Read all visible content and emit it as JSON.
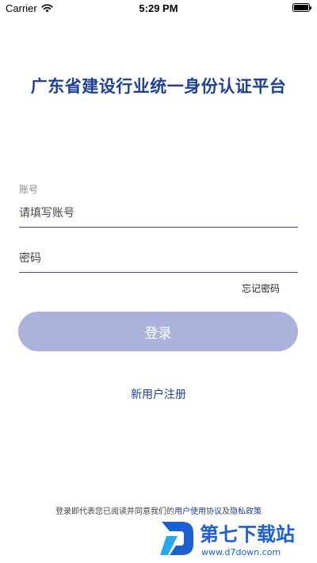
{
  "status_bar": {
    "carrier": "Carrier",
    "time": "5:29 PM",
    "wifi_icon": "wifi-icon",
    "battery_icon": "battery-icon"
  },
  "app": {
    "title": "广东省建设行业统一身份认证平台"
  },
  "form": {
    "account_label": "账号",
    "account_placeholder": "请填写账号",
    "password_placeholder": "密码",
    "forgot_password": "忘记密码",
    "login_button": "登录",
    "register_link": "新用户注册"
  },
  "agreement": {
    "prefix": "登录即代表您已阅读并同意我们的",
    "user_agreement": "用户使用协议",
    "and": "及",
    "privacy_policy": "隐私政策"
  },
  "watermark": {
    "brand": "第七下载站",
    "site": "www.d7down.com"
  },
  "colors": {
    "brand_blue": "#1e3f94",
    "button_bg": "#abb2dc",
    "watermark_blue": "#1b5fd0"
  }
}
